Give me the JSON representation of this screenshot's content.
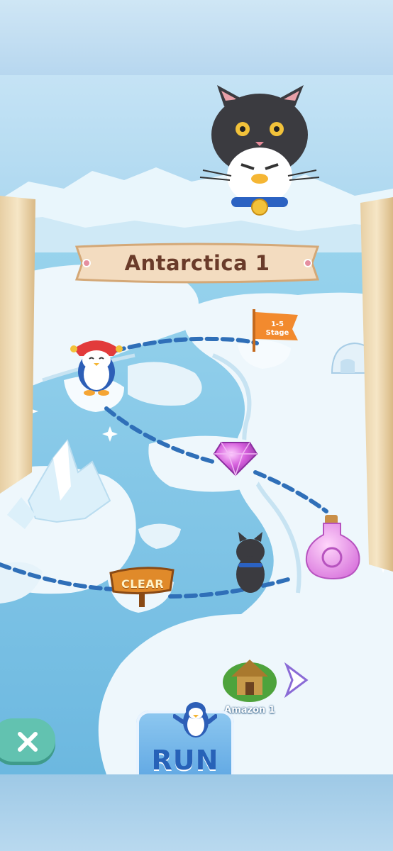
{
  "map": {
    "title": "Antarctica 1",
    "flag_label_line1": "1-5",
    "flag_label_line2": "Stage",
    "clear_label": "CLEAR",
    "next_area_label": "Amazon 1"
  },
  "controls": {
    "run_label": "RUN",
    "close_icon": "close-icon"
  },
  "colors": {
    "water": "#8fd0ea",
    "ice": "#eef7fc",
    "path": "#2f6fb8",
    "banner": "#f3dcc0",
    "flag": "#f28a2e",
    "clear_sign": "#e08a2a",
    "gem": "#d15bd8",
    "run_button": "#5fa7e3",
    "close_button": "#62c2b0"
  }
}
